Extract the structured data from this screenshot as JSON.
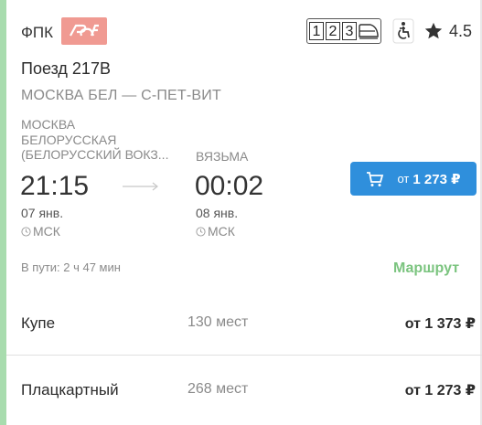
{
  "card": {
    "carrier": "ФПК",
    "carrier_logo": "rzd-logo",
    "car_types": [
      "1",
      "2",
      "3"
    ],
    "rating": "4.5",
    "train_name": "Поезд 217В",
    "route": "МОСКВА БЕЛ — С-ПЕТ-ВИТ",
    "departure": {
      "station_lines": [
        "МОСКВА",
        "БЕЛОРУССКАЯ",
        "(БЕЛОРУССКИЙ ВОКЗ..."
      ],
      "time": "21:15",
      "date": "07 янв.",
      "timezone": "МСК"
    },
    "arrival": {
      "station": "ВЯЗЬМА",
      "time": "00:02",
      "date": "08 янв.",
      "timezone": "МСК"
    },
    "price_button": {
      "from": "от",
      "price": "1 273 ₽"
    },
    "duration": "В пути: 2 ч 47 мин",
    "route_link": "Маршрут",
    "classes": [
      {
        "name": "Купе",
        "seats": "130 мест",
        "price": "от 1 373 ₽"
      },
      {
        "name": "Плацкартный",
        "seats": "268 мест",
        "price": "от 1 273 ₽"
      }
    ]
  },
  "colors": {
    "accent": "#a8dcae",
    "button": "#2f8fdc",
    "route_link": "#7bc47f",
    "logo": "#f09a92"
  }
}
